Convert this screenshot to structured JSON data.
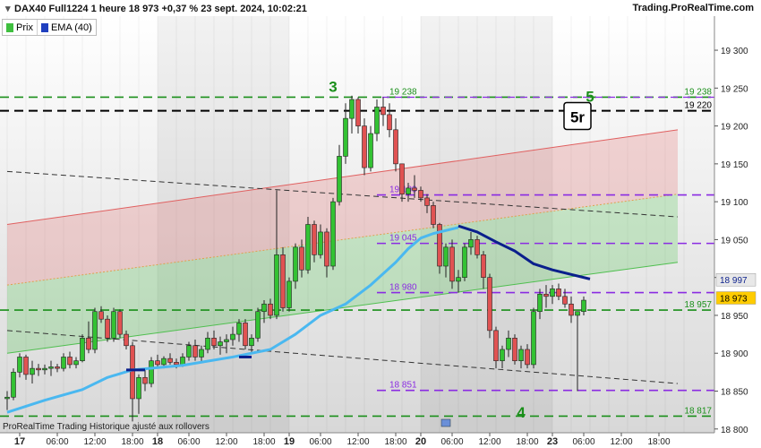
{
  "header": {
    "title": "DAX40 Full1224 1 heure 18 973 +0,37 % 23 sept. 2024, 10:02:21",
    "brand": "Trading.ProRealTime.com"
  },
  "legend": [
    {
      "label": "Prix",
      "color": "#3fbf3f"
    },
    {
      "label": "EMA (40)",
      "color": "#1f3fbf"
    }
  ],
  "footer": "ProRealTime Trading  Historique ajusté aux rollovers",
  "colors": {
    "up": "#33c233",
    "down": "#e05252",
    "ema_light": "#4ab8f0",
    "ema_dark": "#0a1f8c",
    "level_green": "#1a8f1a",
    "level_purple": "#8a2be2",
    "level_black": "#000000",
    "channel_red": "#e06060",
    "channel_green": "#4fbf4f"
  },
  "chart_data": {
    "type": "candlestick",
    "title": "",
    "ylim": [
      18790,
      19350
    ],
    "y_ticks": [
      {
        "v": 19300,
        "label": "19 300"
      },
      {
        "v": 19250,
        "label": "19 250"
      },
      {
        "v": 19200,
        "label": "19 200"
      },
      {
        "v": 19150,
        "label": "19 150"
      },
      {
        "v": 19100,
        "label": "19 100"
      },
      {
        "v": 19050,
        "label": "19 050"
      },
      {
        "v": 19000,
        "label": "19 000"
      },
      {
        "v": 18950,
        "label": "18 950"
      },
      {
        "v": 18900,
        "label": "18 900"
      },
      {
        "v": 18850,
        "label": "18 850"
      },
      {
        "v": 18800,
        "label": "18 800"
      }
    ],
    "x_ticks": [
      {
        "i": 2,
        "label": "17",
        "bold": true
      },
      {
        "i": 8,
        "label": "06:00"
      },
      {
        "i": 14,
        "label": "12:00"
      },
      {
        "i": 20,
        "label": "18:00"
      },
      {
        "i": 24,
        "label": "18",
        "bold": true
      },
      {
        "i": 29,
        "label": "06:00"
      },
      {
        "i": 35,
        "label": "12:00"
      },
      {
        "i": 41,
        "label": "18:00"
      },
      {
        "i": 45,
        "label": "19",
        "bold": true
      },
      {
        "i": 50,
        "label": "06:00"
      },
      {
        "i": 56,
        "label": "12:00"
      },
      {
        "i": 62,
        "label": "18:00"
      },
      {
        "i": 66,
        "label": "20",
        "bold": true
      },
      {
        "i": 71,
        "label": "06:00"
      },
      {
        "i": 77,
        "label": "12:00"
      },
      {
        "i": 83,
        "label": "18:00"
      },
      {
        "i": 87,
        "label": "23",
        "bold": true
      },
      {
        "i": 92,
        "label": "06:00"
      },
      {
        "i": 98,
        "label": "12:00"
      },
      {
        "i": 104,
        "label": "18:00"
      }
    ],
    "candles": [
      [
        18840,
        18850,
        18825,
        18842
      ],
      [
        18842,
        18880,
        18838,
        18875
      ],
      [
        18875,
        18900,
        18868,
        18895
      ],
      [
        18895,
        18898,
        18865,
        18872
      ],
      [
        18872,
        18890,
        18860,
        18880
      ],
      [
        18880,
        18886,
        18870,
        18878
      ],
      [
        18878,
        18885,
        18872,
        18880
      ],
      [
        18880,
        18890,
        18870,
        18882
      ],
      [
        18882,
        18886,
        18875,
        18880
      ],
      [
        18880,
        18900,
        18876,
        18895
      ],
      [
        18895,
        18902,
        18880,
        18885
      ],
      [
        18885,
        18895,
        18880,
        18890
      ],
      [
        18890,
        18925,
        18888,
        18920
      ],
      [
        18920,
        18942,
        18900,
        18905
      ],
      [
        18905,
        18960,
        18900,
        18955
      ],
      [
        18955,
        18962,
        18940,
        18945
      ],
      [
        18945,
        18950,
        18915,
        18920
      ],
      [
        18920,
        18960,
        18915,
        18955
      ],
      [
        18955,
        18958,
        18920,
        18925
      ],
      [
        18925,
        18930,
        18905,
        18910
      ],
      [
        18910,
        18915,
        18810,
        18840
      ],
      [
        18840,
        18872,
        18820,
        18868
      ],
      [
        18868,
        18880,
        18850,
        18860
      ],
      [
        18860,
        18895,
        18855,
        18890
      ],
      [
        18890,
        18898,
        18880,
        18885
      ],
      [
        18885,
        18896,
        18880,
        18893
      ],
      [
        18893,
        18900,
        18885,
        18888
      ],
      [
        18888,
        18893,
        18880,
        18885
      ],
      [
        18885,
        18900,
        18882,
        18895
      ],
      [
        18895,
        18915,
        18890,
        18910
      ],
      [
        18910,
        18918,
        18890,
        18895
      ],
      [
        18895,
        18910,
        18888,
        18905
      ],
      [
        18905,
        18928,
        18900,
        18920
      ],
      [
        18920,
        18930,
        18905,
        18910
      ],
      [
        18910,
        18922,
        18898,
        18915
      ],
      [
        18915,
        18925,
        18900,
        18918
      ],
      [
        18918,
        18935,
        18910,
        18925
      ],
      [
        18925,
        18945,
        18915,
        18940
      ],
      [
        18940,
        18945,
        18905,
        18910
      ],
      [
        18910,
        18925,
        18900,
        18920
      ],
      [
        18920,
        18960,
        18915,
        18955
      ],
      [
        18955,
        18970,
        18940,
        18965
      ],
      [
        18965,
        18972,
        18945,
        18950
      ],
      [
        18950,
        19115,
        18945,
        19030
      ],
      [
        19030,
        19040,
        18955,
        18960
      ],
      [
        18960,
        19000,
        18955,
        18995
      ],
      [
        18995,
        19045,
        18985,
        19040
      ],
      [
        19040,
        19050,
        19000,
        19010
      ],
      [
        19010,
        19080,
        19005,
        19070
      ],
      [
        19070,
        19075,
        19020,
        19030
      ],
      [
        19030,
        19070,
        19025,
        19060
      ],
      [
        19060,
        19065,
        19000,
        19015
      ],
      [
        19015,
        19105,
        19010,
        19100
      ],
      [
        19100,
        19175,
        19095,
        19160
      ],
      [
        19160,
        19230,
        19150,
        19210
      ],
      [
        19210,
        19240,
        19190,
        19235
      ],
      [
        19235,
        19238,
        19190,
        19200
      ],
      [
        19200,
        19210,
        19135,
        19145
      ],
      [
        19145,
        19200,
        19140,
        19190
      ],
      [
        19190,
        19235,
        19180,
        19225
      ],
      [
        19225,
        19238,
        19200,
        19215
      ],
      [
        19215,
        19230,
        19185,
        19195
      ],
      [
        19195,
        19210,
        19140,
        19150
      ],
      [
        19150,
        19120,
        19100,
        19110
      ],
      [
        19110,
        19125,
        19100,
        19118
      ],
      [
        19118,
        19135,
        19105,
        19115
      ],
      [
        19115,
        19120,
        19100,
        19105
      ],
      [
        19105,
        19110,
        19085,
        19095
      ],
      [
        19095,
        19100,
        19065,
        19070
      ],
      [
        19070,
        19072,
        19005,
        19015
      ],
      [
        19015,
        19045,
        19000,
        19040
      ],
      [
        19040,
        19050,
        18985,
        18995
      ],
      [
        18995,
        19010,
        18980,
        19000
      ],
      [
        19000,
        19045,
        18995,
        19040
      ],
      [
        19040,
        19060,
        19030,
        19050
      ],
      [
        19050,
        19055,
        19025,
        19030
      ],
      [
        19030,
        19035,
        18985,
        19000
      ],
      [
        19000,
        19005,
        18920,
        18930
      ],
      [
        18930,
        18935,
        18880,
        18890
      ],
      [
        18890,
        18910,
        18880,
        18905
      ],
      [
        18905,
        18930,
        18895,
        18920
      ],
      [
        18920,
        18925,
        18885,
        18890
      ],
      [
        18890,
        18910,
        18880,
        18905
      ],
      [
        18905,
        18912,
        18880,
        18885
      ],
      [
        18885,
        18960,
        18880,
        18955
      ],
      [
        18955,
        18985,
        18945,
        18978
      ],
      [
        18978,
        18990,
        18960,
        18975
      ],
      [
        18975,
        18990,
        18965,
        18985
      ],
      [
        18985,
        18992,
        18970,
        18975
      ],
      [
        18975,
        18985,
        18960,
        18965
      ],
      [
        18965,
        18975,
        18940,
        18950
      ],
      [
        18950,
        18955,
        18850,
        18955
      ],
      [
        18955,
        18975,
        18950,
        18970
      ]
    ],
    "ema_light": [
      [
        0,
        18822
      ],
      [
        6,
        18838
      ],
      [
        12,
        18852
      ],
      [
        16,
        18868
      ],
      [
        20,
        18878
      ],
      [
        28,
        18884
      ],
      [
        36,
        18895
      ],
      [
        42,
        18905
      ],
      [
        46,
        18925
      ],
      [
        50,
        18950
      ],
      [
        54,
        18965
      ],
      [
        58,
        18990
      ],
      [
        62,
        19020
      ],
      [
        64,
        19038
      ],
      [
        66,
        19052
      ],
      [
        68,
        19058
      ],
      [
        72,
        19066
      ]
    ],
    "ema_dark": [
      [
        72,
        19068
      ],
      [
        75,
        19060
      ],
      [
        78,
        19047
      ],
      [
        81,
        19035
      ],
      [
        84,
        19018
      ],
      [
        87,
        19010
      ],
      [
        90,
        19004
      ],
      [
        93,
        18998
      ]
    ],
    "ema_dark_stubs": [
      {
        "i0": 19,
        "i1": 22,
        "v": 18878
      },
      {
        "i0": 37,
        "i1": 39,
        "v": 18895
      }
    ],
    "levels": [
      {
        "v": 19238,
        "color": "#1a8f1a",
        "label": "19 238",
        "right_label": "19 238"
      },
      {
        "v": 19220,
        "color": "#000000",
        "label": "",
        "right_label": "19 220"
      },
      {
        "v": 19109,
        "color": "#8a2be2",
        "label": "19 109",
        "right_label": ""
      },
      {
        "v": 19045,
        "color": "#8a2be2",
        "label": "19 045",
        "right_label": ""
      },
      {
        "v": 18980,
        "color": "#8a2be2",
        "label": "18 980",
        "right_label": ""
      },
      {
        "v": 18957,
        "color": "#1a8f1a",
        "label": "",
        "right_label": "18 957"
      },
      {
        "v": 18851,
        "color": "#8a2be2",
        "label": "18 851",
        "right_label": ""
      },
      {
        "v": 18817,
        "color": "#1a8f1a",
        "label": "",
        "right_label": "18 817"
      }
    ],
    "purple_top": 19238,
    "trend_lines": [
      {
        "i0": 0,
        "v0": 19140,
        "i1": 107,
        "v1": 19080,
        "color": "#333333"
      },
      {
        "i0": 0,
        "v0": 18930,
        "i1": 107,
        "v1": 18860,
        "color": "#333333"
      }
    ],
    "channel": {
      "upper": [
        [
          0,
          19070
        ],
        [
          107,
          19195
        ]
      ],
      "mid": [
        [
          0,
          18990
        ],
        [
          107,
          19110
        ]
      ],
      "lower": [
        [
          0,
          18900
        ],
        [
          107,
          19020
        ]
      ]
    },
    "wave_labels": [
      {
        "i": 52,
        "v": 19245,
        "label": "3"
      },
      {
        "i": 82,
        "v": 18815,
        "label": "4"
      },
      {
        "i": 93,
        "v": 19232,
        "label": "5"
      }
    ],
    "boxed_label": {
      "i": 91,
      "v": 19212,
      "label": "5r"
    },
    "price_tags": [
      {
        "v": 18997,
        "label": "18 997",
        "bg": "#e8e8e8",
        "fg": "#0a1f8c"
      },
      {
        "v": 18973,
        "label": "18 973",
        "bg": "#ffcc00",
        "fg": "#000000"
      }
    ]
  }
}
